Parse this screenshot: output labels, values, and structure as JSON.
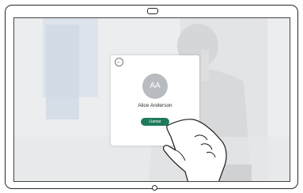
{
  "dialog": {
    "back_icon": "←",
    "avatar_initials": "AA",
    "contact_name": "Alice Anderson",
    "call_button_label": "Llamar"
  },
  "colors": {
    "call_button": "#1e7a5a",
    "avatar": "#b8bcc0"
  },
  "icons": [
    "camera-icon",
    "back-arrow-icon",
    "home-button-icon",
    "hand-pointer-icon"
  ]
}
